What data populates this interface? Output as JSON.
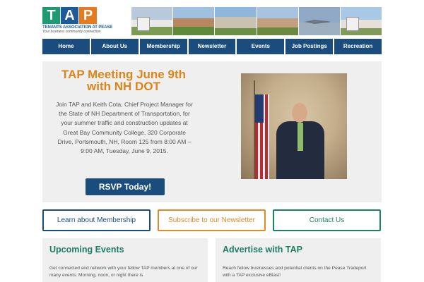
{
  "header": {
    "logo": {
      "letters": [
        "T",
        "A",
        "P"
      ],
      "name": "TENANTS ASSOCIATION AT PEASE",
      "tagline": "Your business community connection"
    },
    "photos": [
      "building-sign",
      "office-building",
      "glass-building",
      "brick-building",
      "fighter-jets",
      "pease-sign"
    ]
  },
  "nav": {
    "items": [
      "Home",
      "About Us",
      "Membership",
      "Newsletter",
      "Events",
      "Job Postings",
      "Recreation"
    ]
  },
  "hero": {
    "title": "TAP Meeting June 9th with NH DOT",
    "body": "Join TAP and Keith Cota, Chief Project Manager for the State of NH Department of Transportation, for your summer traffic and construction updates at Great Bay Community College, 320 Corporate Drive, Portsmouth, NH, Room 125 from 8:00 AM – 9:00 AM, Tuesday, June 9, 2015.",
    "rsvp_label": "RSVP Today!"
  },
  "cta": {
    "membership": "Learn about Membership",
    "newsletter": "Subscribe to our Newsletter",
    "contact": "Contact Us"
  },
  "panels": {
    "events": {
      "title": "Upcoming Events",
      "text": "Get connected and network with your fellow TAP members at one of our many events. Morning, noon, or night there is"
    },
    "advertise": {
      "title": "Advertise with TAP",
      "text": "Reach fellow businesses and potential clients on the Pease Tradeport with a TAP exclusive eBlast!"
    }
  },
  "colors": {
    "navy": "#1a4d7e",
    "orange": "#e08a2c",
    "green": "#1e8165",
    "panel_bg": "#efefef"
  }
}
